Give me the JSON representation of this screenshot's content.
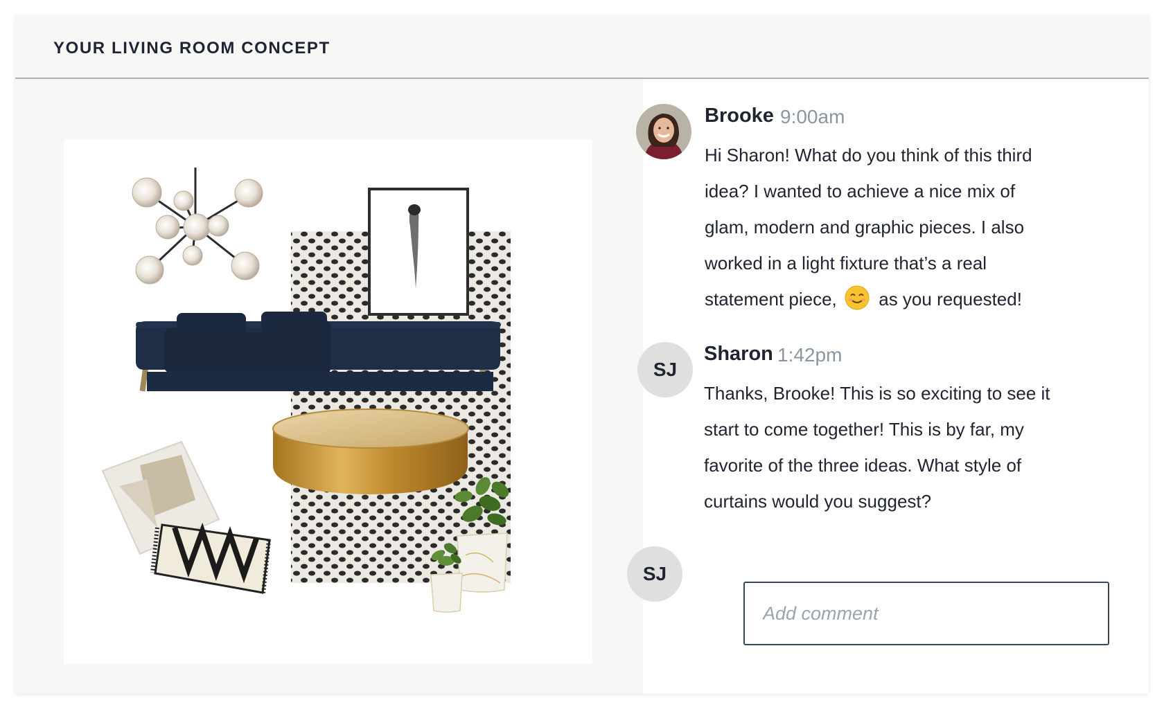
{
  "header": {
    "title": "YOUR LIVING ROOM CONCEPT"
  },
  "moodboard": {
    "image_name": "living-room-moodboard"
  },
  "comments": [
    {
      "author": "Brooke",
      "time": "9:00am",
      "avatar": "photo",
      "text_before_emoji": "Hi Sharon! What do you think of this third idea? I wanted to achieve a nice mix of glam, modern and graphic pieces. I also worked in a light fixture that’s a real statement piece,",
      "emoji": "smiling-face-emoji",
      "text_after_emoji": "as you requested!"
    },
    {
      "author": "Sharon",
      "time": "1:42pm",
      "avatar_initials": "SJ",
      "text": "Thanks, Brooke! This is so exciting to see it start to come together! This is by far, my favorite of the three ideas. What style of curtains would you suggest?"
    }
  ],
  "composer": {
    "avatar_initials": "SJ",
    "placeholder": "Add comment",
    "value": ""
  },
  "colors": {
    "card_background": "#f7f7f6",
    "divider": "#aab4bd",
    "text": "#1f2430",
    "muted": "#8a96a2",
    "input_border": "#39465a",
    "avatar_bg": "#dfdfdf"
  }
}
